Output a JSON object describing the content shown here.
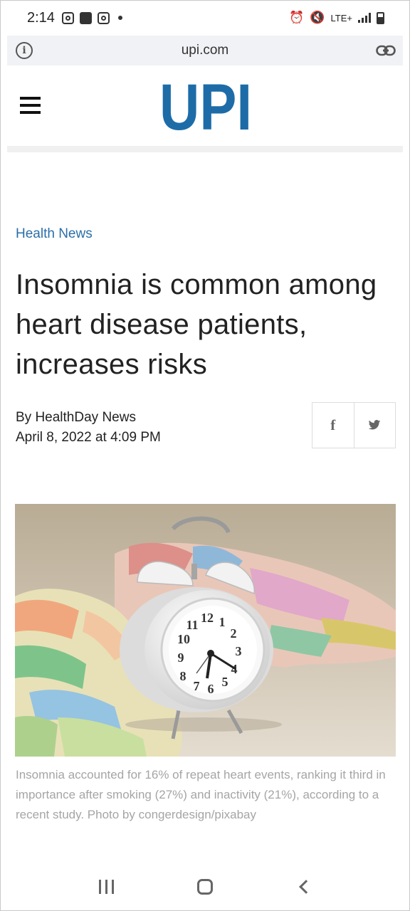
{
  "status_bar": {
    "time": "2:14",
    "network_label": "LTE+"
  },
  "url_bar": {
    "url": "upi.com",
    "info_glyph": "i"
  },
  "header": {
    "logo_text": "UPI",
    "logo_color": "#1d6ca8"
  },
  "article": {
    "category": "Health News",
    "headline": "Insomnia is common among heart disease patients, increases risks",
    "byline": "By HealthDay News",
    "date": "April 8, 2022 at 4:09 PM",
    "share": {
      "facebook_glyph": "f",
      "twitter_glyph": "🐦"
    },
    "image_caption": "Insomnia accounted for 16% of repeat heart events, ranking it third in importance after smoking (27%) and inactivity (21%), according to a recent study. Photo by congerdesign/pixabay",
    "clock_numbers": [
      "12",
      "1",
      "2",
      "3",
      "4",
      "5",
      "6",
      "7",
      "8",
      "9",
      "10",
      "11"
    ]
  },
  "colors": {
    "link": "#2a6fa8",
    "caption": "#a5a5a5"
  }
}
